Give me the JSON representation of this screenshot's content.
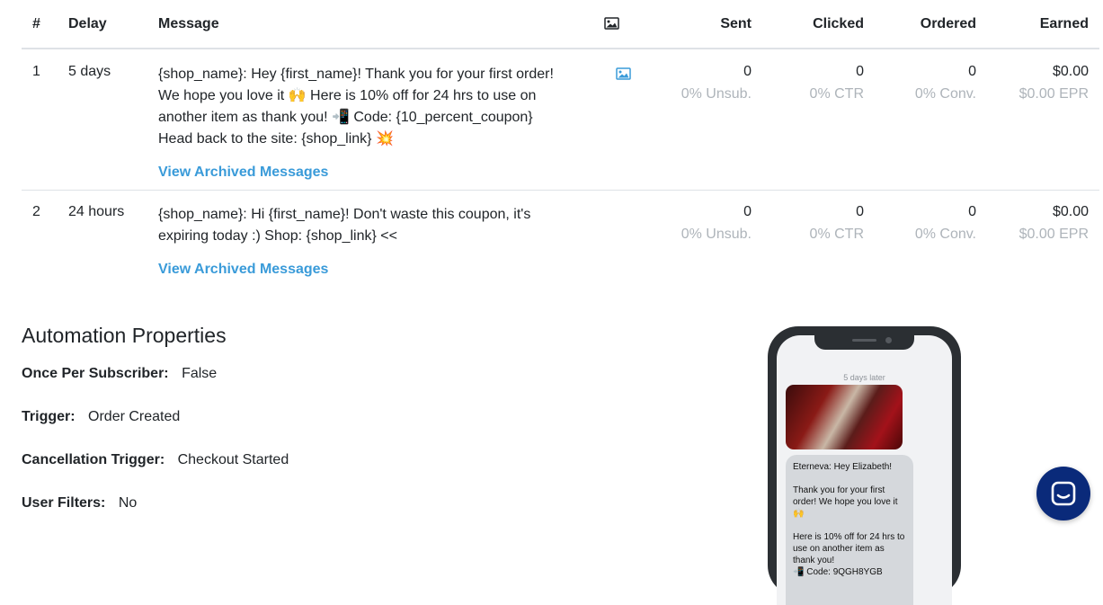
{
  "table": {
    "headers": {
      "index": "#",
      "delay": "Delay",
      "message": "Message",
      "sent": "Sent",
      "clicked": "Clicked",
      "ordered": "Ordered",
      "earned": "Earned"
    },
    "rows": [
      {
        "index": "1",
        "delay": "5 days",
        "message": "{shop_name}: Hey {first_name}! Thank you for your first order! We hope you love it 🙌 Here is 10% off for 24 hrs to use on another item as thank you! 📲 Code: {10_percent_coupon} Head back to the site: {shop_link} 💥",
        "archived_link": "View Archived Messages",
        "sent": "0",
        "unsub": "0% Unsub.",
        "clicked": "0",
        "ctr": "0% CTR",
        "ordered": "0",
        "conv": "0% Conv.",
        "earned": "$0.00",
        "epr": "$0.00 EPR"
      },
      {
        "index": "2",
        "delay": "24 hours",
        "message": "{shop_name}: Hi {first_name}! Don't waste this coupon, it's expiring today :) Shop: {shop_link} <<",
        "archived_link": "View Archived Messages",
        "sent": "0",
        "unsub": "0% Unsub.",
        "clicked": "0",
        "ctr": "0% CTR",
        "ordered": "0",
        "conv": "0% Conv.",
        "earned": "$0.00",
        "epr": "$0.00 EPR"
      }
    ]
  },
  "properties": {
    "title": "Automation Properties",
    "once_label": "Once Per Subscriber:",
    "once_value": "False",
    "trigger_label": "Trigger:",
    "trigger_value": "Order Created",
    "cancel_label": "Cancellation Trigger:",
    "cancel_value": "Checkout Started",
    "filters_label": "User Filters:",
    "filters_value": "No"
  },
  "phone_preview": {
    "timestamp": "5 days later",
    "bubble_text": "Eterneva: Hey Elizabeth!\n\nThank you for your first order! We hope you love it 🙌\n\nHere is 10% off for 24 hrs to use on another item as thank you!\n📲 Code: 9QGH8YGB"
  },
  "colors": {
    "link": "#3a9bd9",
    "muted": "#aeb4ba",
    "launcher": "#0a2a7a"
  },
  "icons": {
    "image_column": "image-icon",
    "chat": "chat-icon"
  }
}
